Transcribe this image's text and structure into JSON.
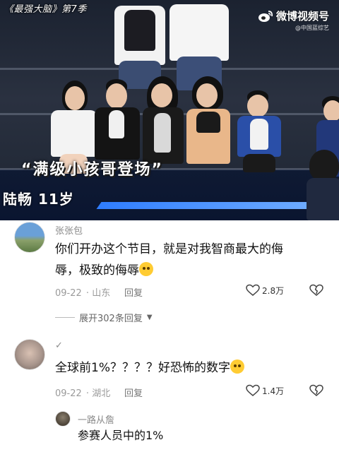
{
  "video": {
    "show_title": "《最强大脑》第7季",
    "platform_name": "微博视频号",
    "platform_sub": "@中国蓝综艺",
    "caption": "“满级小孩哥登场”",
    "contestant_tag": "陆畅 11岁"
  },
  "comments": [
    {
      "username": "张张包",
      "text_line1": "你们开办这个节目，就是对我智商最大的侮",
      "text_line2": "辱，极致的侮辱",
      "emoji": "crying-emoji",
      "date": "09-22",
      "location": "山东",
      "reply_label": "回复",
      "likes": "2.8万",
      "expand_label": "展开302条回复"
    },
    {
      "username": "✓",
      "text": "全球前1%？？？？好恐怖的数字",
      "emoji": "scared-emoji",
      "date": "09-22",
      "location": "湖北",
      "reply_label": "回复",
      "likes": "1.4万",
      "reply": {
        "username": "一路从詹",
        "text": "参赛人员中的1%"
      }
    }
  ],
  "colors": {
    "text_primary": "#111111",
    "text_muted": "#9a9a9a",
    "stage_blue": "#2f7dff"
  }
}
